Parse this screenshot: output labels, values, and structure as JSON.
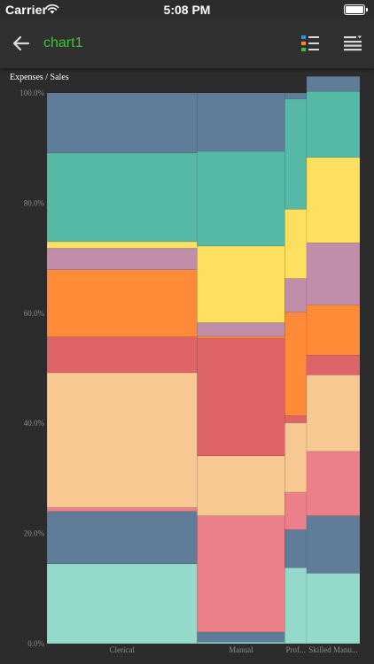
{
  "status_bar": {
    "carrier": "Carrier",
    "time": "5:08 PM"
  },
  "nav": {
    "title": "chart1",
    "title_color": "#3fc23f"
  },
  "chart_header": "Expenses / Sales",
  "chart_data": {
    "type": "bar",
    "subtype": "marimekko (100% stacked, variable width)",
    "ylabel": "Expenses / Sales",
    "ylim": [
      0,
      100
    ],
    "y_ticks": [
      "0.0%",
      "20.0%",
      "40.0%",
      "60.0%",
      "80.0%",
      "100.0%"
    ],
    "categories": [
      "Clerical",
      "Manual",
      "Prof...",
      "Skilled Manu..."
    ],
    "column_weights": [
      48,
      28,
      7,
      17
    ],
    "series_colors": [
      "#95d9cb",
      "#5f7d98",
      "#ec808a",
      "#f7c891",
      "#de6467",
      "#ff8b38",
      "#c08ea8",
      "#ffe05e",
      "#56b9a5",
      "#5f7d98"
    ],
    "columns": [
      {
        "category": "Clerical",
        "segments": [
          14.5,
          9.5,
          0.7,
          24.5,
          6.5,
          12.2,
          3.9,
          1.2,
          16.1,
          10.9
        ]
      },
      {
        "category": "Manual",
        "segments": [
          0.3,
          1.8,
          21.1,
          10.9,
          21.3,
          0.4,
          2.5,
          13.9,
          17.2,
          10.6
        ]
      },
      {
        "category": "Prof...",
        "segments": [
          13.8,
          6.9,
          6.8,
          12.6,
          1.3,
          18.8,
          6.1,
          12.6,
          20.0,
          1.1
        ]
      },
      {
        "category": "Skilled Manu...",
        "segments": [
          12.8,
          10.4,
          11.7,
          13.9,
          3.6,
          9.1,
          11.3,
          15.5,
          12.0,
          2.7
        ]
      }
    ],
    "grid": false,
    "legend": "none"
  }
}
